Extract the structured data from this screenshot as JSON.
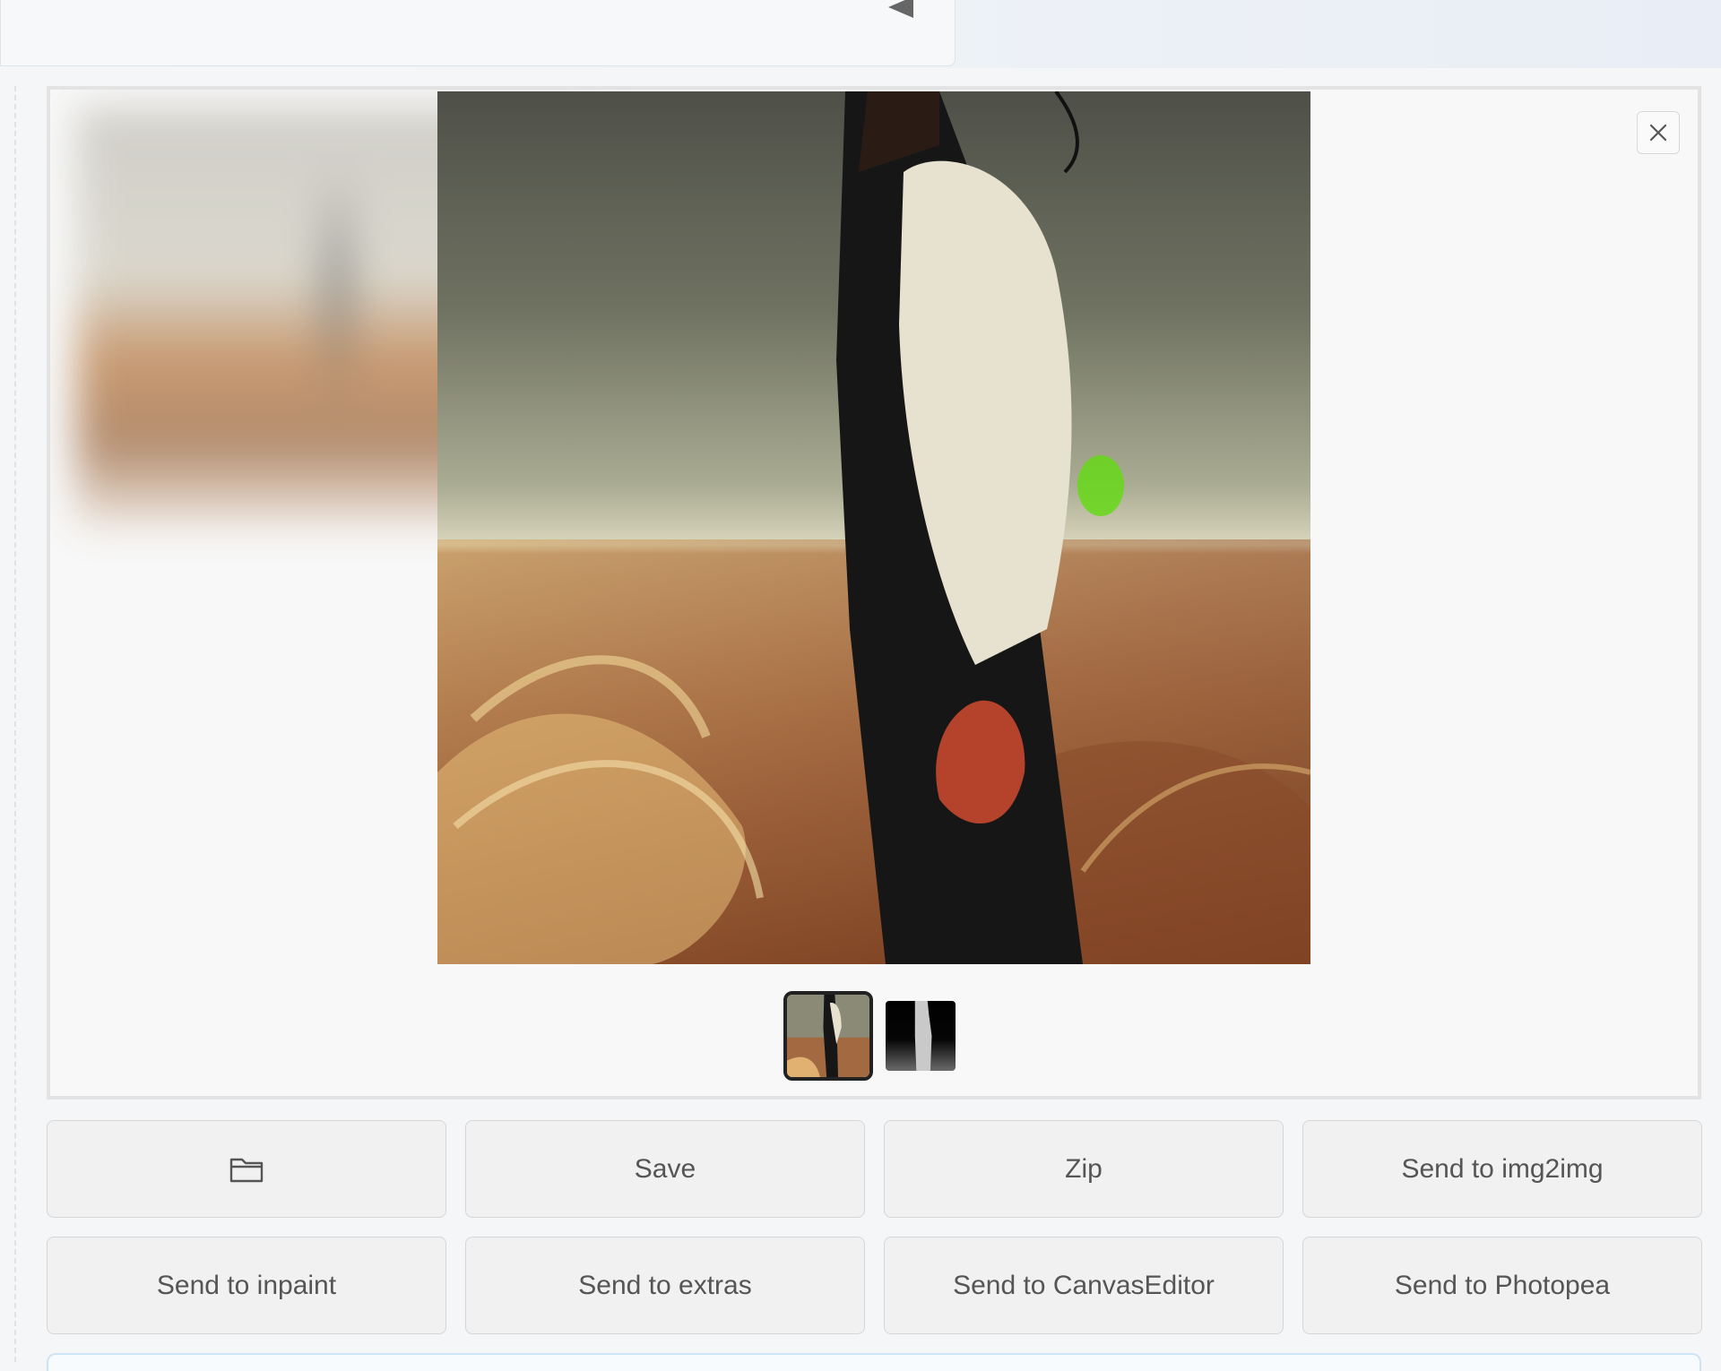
{
  "header": {
    "collapse_icon": "triangle-left-icon"
  },
  "gallery": {
    "close_icon": "close-icon",
    "main_image_alt": "",
    "thumbnails": [
      {
        "state": "selected"
      },
      {
        "state": "default"
      }
    ]
  },
  "actions": {
    "open_folder_icon": "folder-icon",
    "save_label": "Save",
    "zip_label": "Zip",
    "send_img2img_label": "Send to img2img",
    "send_inpaint_label": "Send to inpaint",
    "send_extras_label": "Send to extras",
    "send_canvaseditor_label": "Send to CanvasEditor",
    "send_photopea_label": "Send to Photopea"
  },
  "colors": {
    "page_bg": "#f4f6f8",
    "button_bg": "#f1f1f1",
    "button_text": "#555555",
    "gallery_border": "#e3e3e3",
    "thumbnail_selected_border": "#222222"
  }
}
